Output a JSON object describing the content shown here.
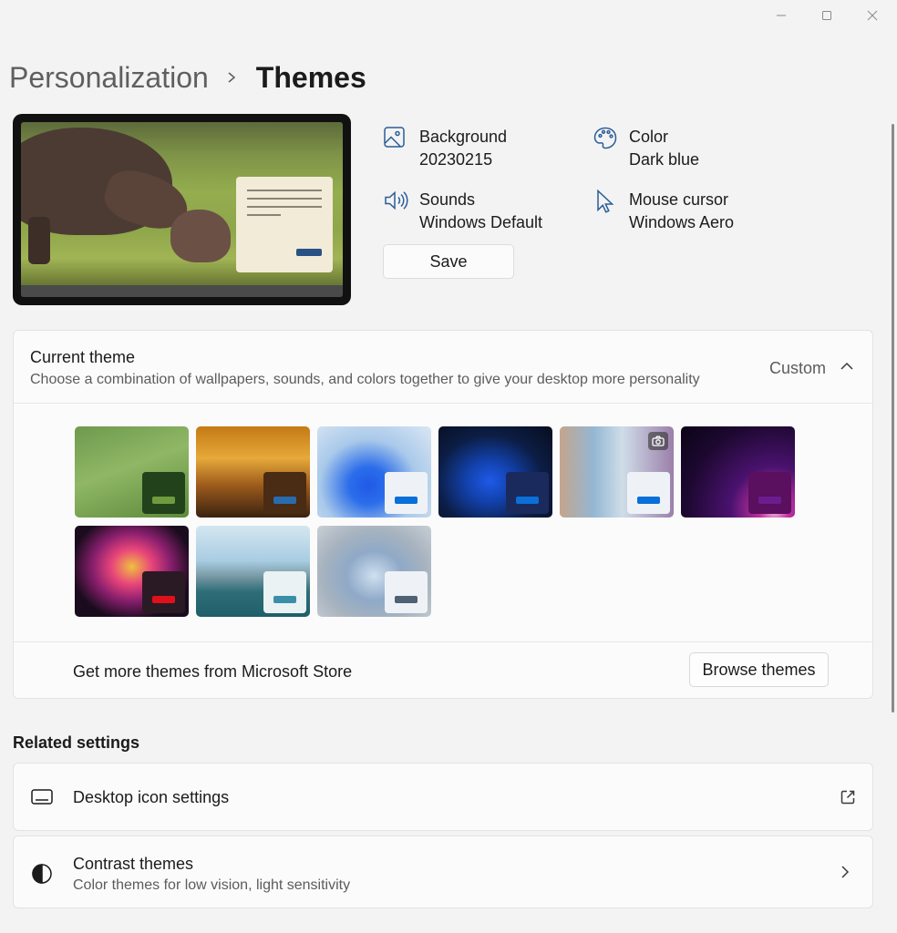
{
  "window": {
    "minimize_icon": "minimize-icon",
    "maximize_icon": "maximize-icon",
    "close_icon": "close-icon"
  },
  "breadcrumb": {
    "parent": "Personalization",
    "separator_icon": "chevron-right-icon",
    "current": "Themes"
  },
  "preview": {
    "description_icon": "theme-preview"
  },
  "properties": {
    "background": {
      "label": "Background",
      "value": "20230215",
      "icon": "image-icon"
    },
    "color": {
      "label": "Color",
      "value": "Dark blue",
      "icon": "palette-icon"
    },
    "sounds": {
      "label": "Sounds",
      "value": "Windows Default",
      "icon": "speaker-icon"
    },
    "cursor": {
      "label": "Mouse cursor",
      "value": "Windows Aero",
      "icon": "cursor-icon"
    },
    "save_label": "Save"
  },
  "current_theme": {
    "title": "Current theme",
    "description": "Choose a combination of wallpapers, sounds, and colors together to give your desktop more personality",
    "value": "Custom",
    "expanded": true,
    "themes": [
      {
        "swatch": "#22421b",
        "accent": "#6f9a3e"
      },
      {
        "swatch": "#4a2b13",
        "accent": "#2a6bb0"
      },
      {
        "swatch": "#eef2f7",
        "accent": "#0a6fd8"
      },
      {
        "swatch": "#1a2a5c",
        "accent": "#0a6fd8"
      },
      {
        "swatch": "#eef2f7",
        "accent": "#0a6fd8"
      },
      {
        "swatch": "#5a0f5f",
        "accent": "#6b1d8f"
      },
      {
        "swatch": "#2a1a24",
        "accent": "#e0101a"
      },
      {
        "swatch": "#eaf2f4",
        "accent": "#3a8fa8"
      },
      {
        "swatch": "#eef2f7",
        "accent": "#4f6275"
      }
    ],
    "store_text": "Get more themes from Microsoft Store",
    "browse_label": "Browse themes"
  },
  "related": {
    "title": "Related settings",
    "desktop_icons": {
      "title": "Desktop icon settings",
      "icon": "monitor-icon",
      "trail_icon": "external-link-icon"
    },
    "contrast": {
      "title": "Contrast themes",
      "subtitle": "Color themes for low vision, light sensitivity",
      "icon": "contrast-icon",
      "trail_icon": "chevron-right-icon"
    }
  }
}
